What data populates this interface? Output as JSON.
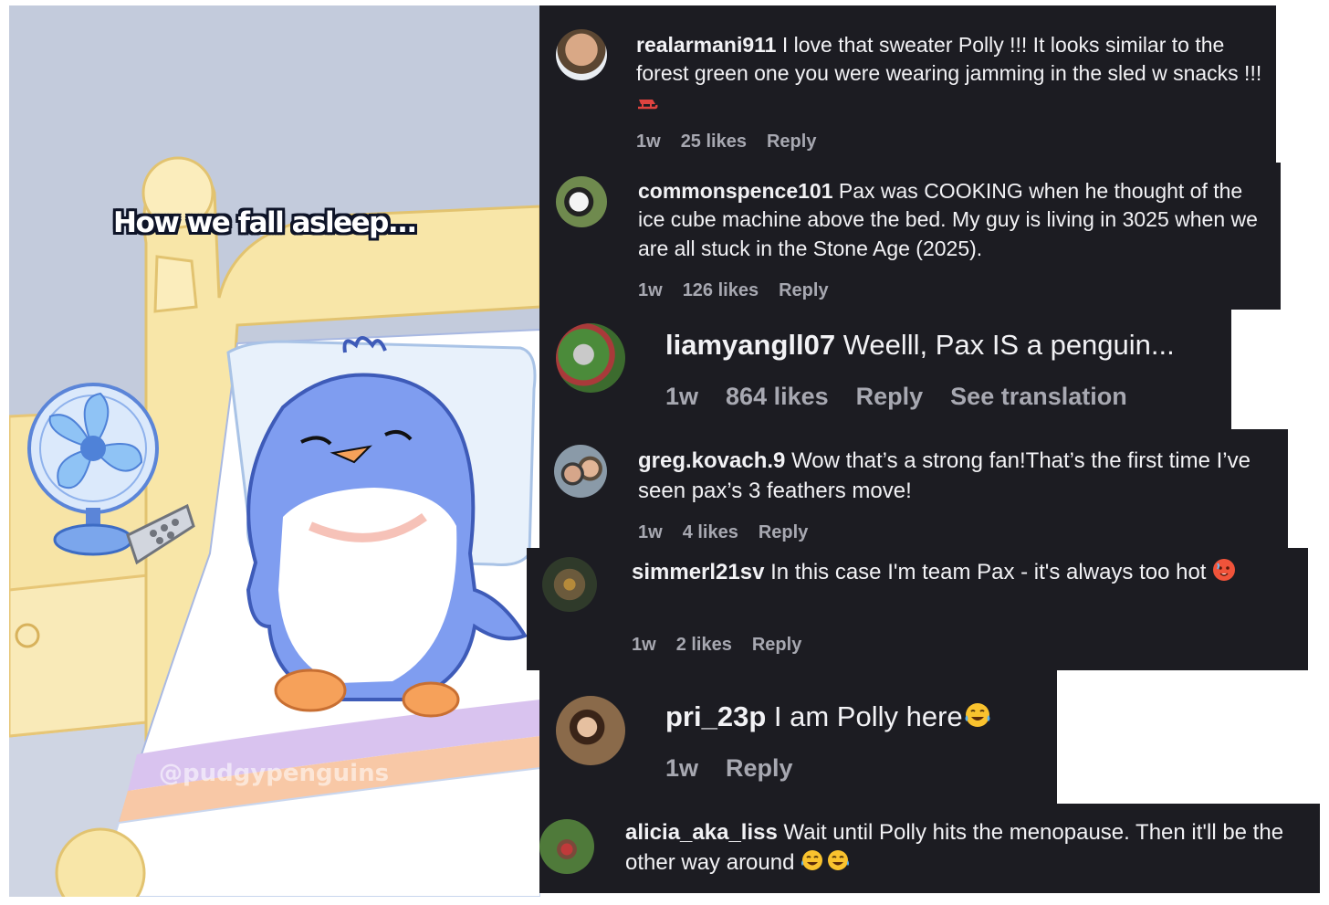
{
  "illustration": {
    "caption": "How we fall asleep...",
    "watermark": "@pudgypenguins"
  },
  "comments": [
    {
      "username": "realarmani911",
      "text": "I love that sweater Polly !!! It looks similar to the forest green one you were wearing jamming in the sled w snacks !!!",
      "emoji": "sled",
      "time": "1w",
      "likes": "25 likes",
      "reply": "Reply"
    },
    {
      "username": "commonspence101",
      "text": "Pax was COOKING when he thought of the ice cube machine above the bed. My guy is living in 3025 when we are all stuck in the Stone Age (2025).",
      "time": "1w",
      "likes": "126 likes",
      "reply": "Reply"
    },
    {
      "username": "liamyangll07",
      "text": "Weelll, Pax IS a penguin...",
      "time": "1w",
      "likes": "864 likes",
      "reply": "Reply",
      "translate": "See translation"
    },
    {
      "username": "greg.kovach.9",
      "text": "Wow that’s a strong fan!That’s the first time I’ve seen pax’s 3 feathers move!",
      "time": "1w",
      "likes": "4 likes",
      "reply": "Reply"
    },
    {
      "username": "simmerl21sv",
      "text": "In this case I'm team Pax - it's always too hot",
      "emoji": "hot-face",
      "time": "1w",
      "likes": "2 likes",
      "reply": "Reply"
    },
    {
      "username": "pri_23p",
      "text": "I am Polly here",
      "emoji": "tears-of-joy",
      "time": "1w",
      "reply": "Reply"
    },
    {
      "username": "alicia_aka_liss",
      "text": "Wait until Polly hits the menopause. Then it'll be the other way around",
      "emoji": "tears-of-joy x2"
    }
  ],
  "colors": {
    "comment_bg": "#1c1c22",
    "text": "#f2f2f5",
    "meta": "#a7a8b1",
    "penguin_blue": "#7f9df0"
  }
}
